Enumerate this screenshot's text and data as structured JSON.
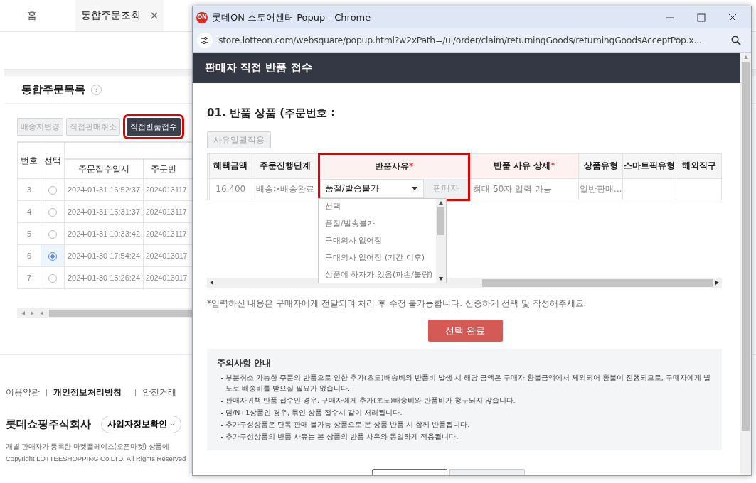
{
  "background_page": {
    "tabs": [
      {
        "label": "홈",
        "selected": false,
        "closable": false
      },
      {
        "label": "통합주문조회",
        "selected": true,
        "closable": true
      }
    ],
    "section_title": "통합주문목록",
    "help_icon": "?",
    "actions": [
      {
        "label": "배송지변경",
        "disabled": true,
        "highlighted": false
      },
      {
        "label": "직접판매취소",
        "disabled": true,
        "highlighted": false
      },
      {
        "label": "직접반품접수",
        "disabled": false,
        "highlighted": true
      }
    ],
    "table": {
      "columns": [
        "번호",
        "선택",
        "주문접수일시",
        "주문번"
      ],
      "rows": [
        {
          "no": "3",
          "selected": false,
          "date": "2024-01-31 16:52:37",
          "order": "2024013117"
        },
        {
          "no": "4",
          "selected": false,
          "date": "2024-01-31 15:31:37",
          "order": "2024013117"
        },
        {
          "no": "5",
          "selected": false,
          "date": "2024-01-31 10:33:42",
          "order": "2024013117"
        },
        {
          "no": "6",
          "selected": true,
          "date": "2024-01-30 17:54:24",
          "order": "2024013017"
        },
        {
          "no": "7",
          "selected": false,
          "date": "2024-01-30 15:26:24",
          "order": "2024013017"
        }
      ]
    },
    "footer": {
      "links": [
        {
          "label": "이용약관",
          "bold": false
        },
        {
          "label": "개인정보처리방침",
          "bold": true
        },
        {
          "label": "안전거래",
          "bold": false
        }
      ],
      "company": "롯데쇼핑주식회사",
      "company_button": "사업자정보확인",
      "notice": "개별 판매자가 등록한 마켓플레이스(오픈마켓) 상품에",
      "copyright": "Copyright LOTTEESHOPPING Co.LTD. All Rights Reserved"
    }
  },
  "popup": {
    "window_title": "롯데ON 스토어센터 Popup - Chrome",
    "logo": "ON",
    "url": "store.lotteon.com/websquare/popup.html?w2xPath=/ui/order/claim/returningGoods/returningGoodsAcceptPop.x...",
    "header": "판매자 직접 반품 접수",
    "section_title": "01. 반품 상품 (주문번호 :",
    "bulk_button": {
      "label": "사유일괄적용",
      "disabled": true
    },
    "table": {
      "required_mark": "*",
      "columns": [
        {
          "label": "혜택금액",
          "required": false,
          "highlighted": false
        },
        {
          "label": "주문진행단계",
          "required": false,
          "highlighted": false
        },
        {
          "label": "반품사유",
          "required": true,
          "highlighted": true
        },
        {
          "label": "반품 사유 상세",
          "required": true,
          "highlighted": false
        },
        {
          "label": "상품유형",
          "required": false,
          "highlighted": false
        },
        {
          "label": "스마트픽유형",
          "required": false,
          "highlighted": false
        },
        {
          "label": "해외직구",
          "required": false,
          "highlighted": false
        }
      ],
      "row": {
        "benefit": "16,400",
        "stage": "배송>배송완료",
        "reason": "품절/발송불가",
        "reason_owner": "판매자",
        "detail_placeholder": "최대 50자 입력 가능",
        "product_type": "일반판매..."
      }
    },
    "dropdown_options": [
      "선택",
      "품절/발송불가",
      "구매의사 없어짐",
      "구매의사 없어짐 (기간 이후)",
      "상품에 하자가 있음(파손/불량)"
    ],
    "note": "*입력하신 내용은 구매자에게 전달되며 처리 후 수정 불가능합니다. 신중하게 선택 및 작성해주세요.",
    "confirm_button": "선택 완료",
    "notice": {
      "title": "주의사항 안내",
      "items": [
        "부분취소 가능한 주문의 반품으로 인한 추가(초도)배송비와 반품비 발생 시 해당 금액은 구매자 환불금액에서 제외되어 환불이 진행되므로, 구매자에게 별도로 배송비를 받으실 필요가 없습니다.",
        "판매자귀책 반품 접수인 경우, 구매자에게 추가(초도)배송비와 반품비가 청구되지 않습니다.",
        "덤/N+1상품인 경우, 묶인 상품 접수시 같이 처리됩니다.",
        "추가구성상품은 단독 판매 불가능 상품으로 본 상품 반품 시 함께 반품됩니다.",
        "추가구성상품의 반품 사유는 본 상품의 반품 사유와 동일하게 적용됩니다."
      ]
    }
  }
}
